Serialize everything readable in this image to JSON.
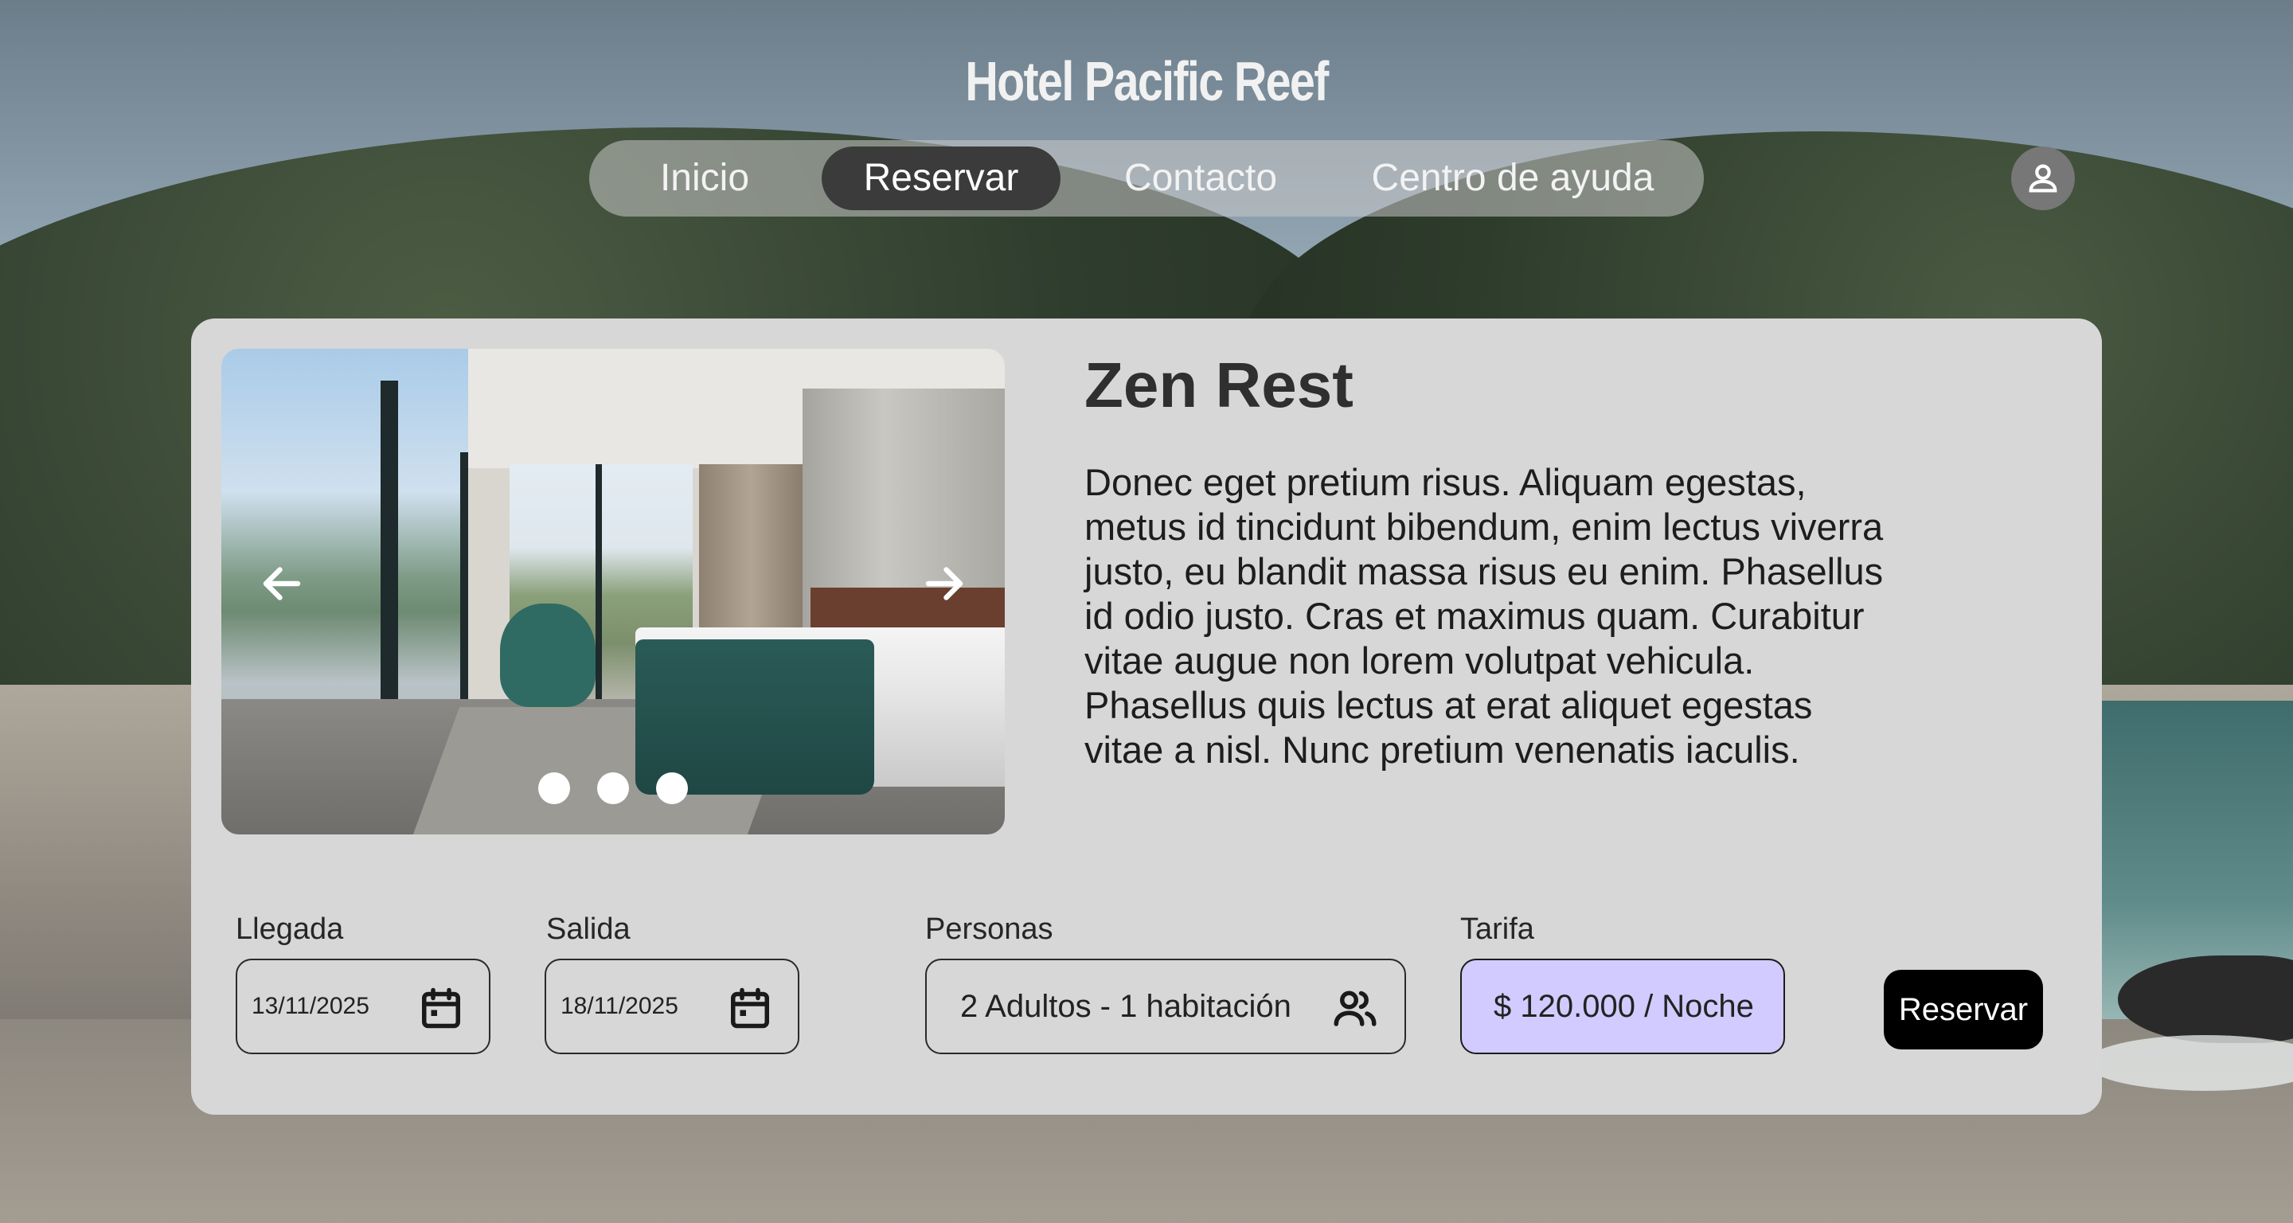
{
  "site": {
    "title": "Hotel Pacific Reef"
  },
  "nav": {
    "items": [
      {
        "label": "Inicio"
      },
      {
        "label": "Reservar",
        "active": true
      },
      {
        "label": "Contacto"
      },
      {
        "label": "Centro de ayuda"
      }
    ],
    "user_icon": "user-icon"
  },
  "room": {
    "name": "Zen Rest",
    "description": "Donec eget pretium risus. Aliquam egestas, metus id tincidunt bibendum, enim lectus viverra justo, eu blandit massa risus eu enim. Phasellus id odio justo. Cras et maximus quam. Curabitur vitae augue non lorem volutpat vehicula. Phasellus quis lectus at erat aliquet egestas vitae a nisl. Nunc pretium venenatis iaculis.",
    "gallery": {
      "prev_icon": "chevron-left-icon",
      "next_icon": "chevron-right-icon",
      "slides": 3
    }
  },
  "booking": {
    "arrival": {
      "label": "Llegada",
      "value": "13/11/2025",
      "icon": "calendar-icon"
    },
    "departure": {
      "label": "Salida",
      "value": "18/11/2025",
      "icon": "calendar-icon"
    },
    "people": {
      "label": "Personas",
      "value": "2 Adultos - 1 habitación",
      "icon": "people-icon"
    },
    "rate": {
      "label": "Tarifa",
      "value": "$ 120.000 / Noche"
    },
    "reserve_label": "Reservar"
  },
  "colors": {
    "card": "#d7d7d7",
    "nav_active": "#3b3b3b",
    "rate_field": "#d1cbff",
    "button": "#000000"
  }
}
